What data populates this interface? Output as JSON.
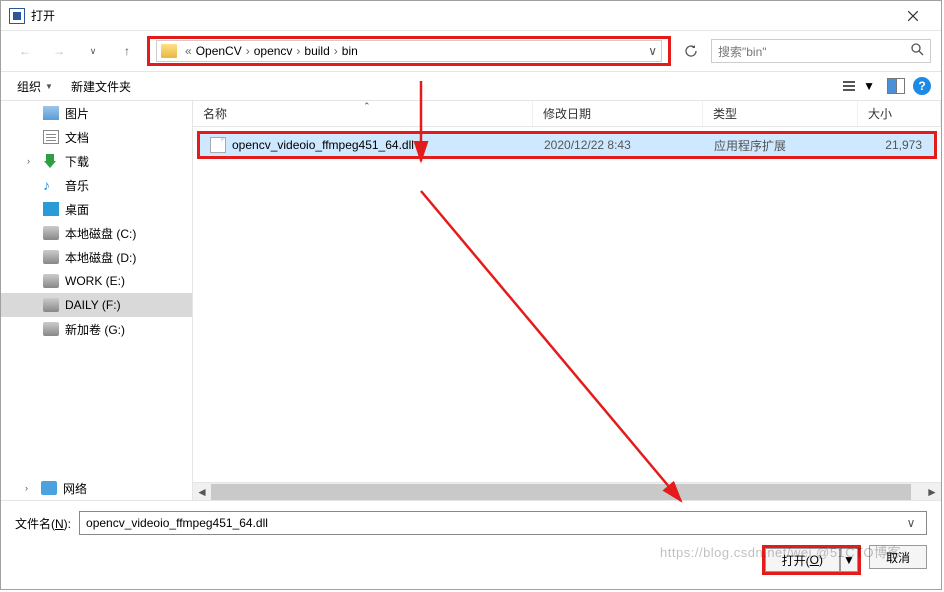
{
  "window": {
    "title": "打开"
  },
  "nav": {
    "crumbs": [
      "OpenCV",
      "opencv",
      "build",
      "bin"
    ],
    "search_placeholder": "搜索\"bin\""
  },
  "toolbar": {
    "organize": "组织",
    "newfolder": "新建文件夹"
  },
  "sidebar": {
    "items": [
      {
        "label": "图片",
        "icon": "pic"
      },
      {
        "label": "文档",
        "icon": "doc"
      },
      {
        "label": "下载",
        "icon": "dl",
        "caret": true
      },
      {
        "label": "音乐",
        "icon": "music"
      },
      {
        "label": "桌面",
        "icon": "desk"
      },
      {
        "label": "本地磁盘 (C:)",
        "icon": "disk"
      },
      {
        "label": "本地磁盘 (D:)",
        "icon": "disk"
      },
      {
        "label": "WORK (E:)",
        "icon": "disk"
      },
      {
        "label": "DAILY (F:)",
        "icon": "disk",
        "selected": true
      },
      {
        "label": "新加卷 (G:)",
        "icon": "disk"
      }
    ],
    "network": "网络"
  },
  "columns": {
    "name": "名称",
    "date": "修改日期",
    "type": "类型",
    "size": "大小"
  },
  "rows": [
    {
      "name": "opencv_videoio_ffmpeg451_64.dll",
      "date": "2020/12/22 8:43",
      "type": "应用程序扩展",
      "size": "21,973"
    }
  ],
  "filename": {
    "label_pre": "文件名(",
    "label_u": "N",
    "label_post": "):",
    "value": "opencv_videoio_ffmpeg451_64.dll"
  },
  "buttons": {
    "open_pre": "打开(",
    "open_u": "O",
    "open_post": ")",
    "cancel": "取消"
  },
  "watermark": "https://blog.csdn.net/wei @51CTO博客"
}
